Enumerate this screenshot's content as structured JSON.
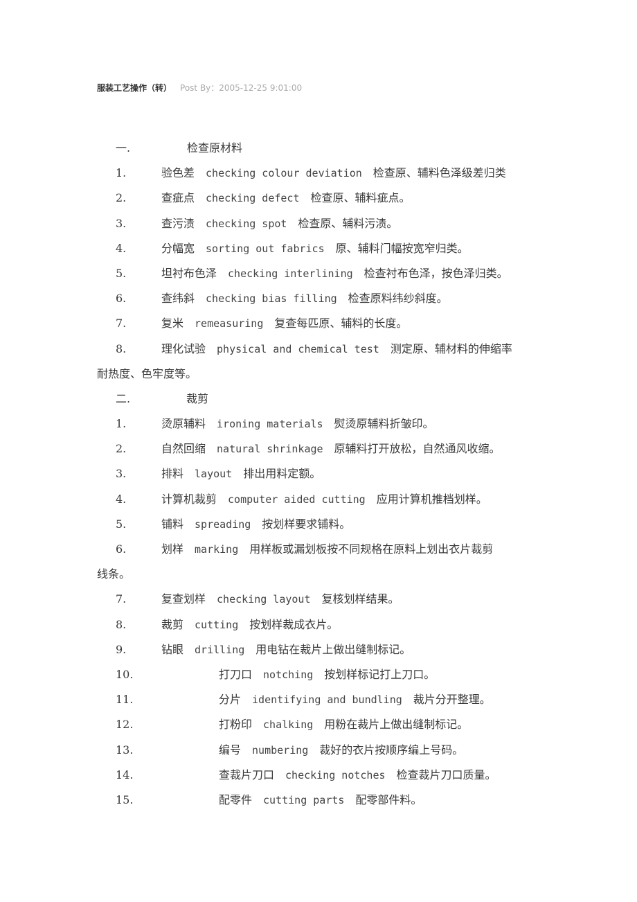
{
  "header": {
    "title": "服装工艺操作（转）",
    "meta": "Post By：2005-12-25 9:01:00"
  },
  "sections": [
    {
      "number": "一.",
      "title": "检查原材料",
      "items": [
        {
          "num": "1.",
          "zh": "验色差",
          "en": "checking colour deviation",
          "desc": "检查原、辅料色泽级差归类",
          "cont": ""
        },
        {
          "num": "2.",
          "zh": "查疵点",
          "en": "checking defect",
          "desc": "检查原、辅料疵点。",
          "cont": ""
        },
        {
          "num": "3.",
          "zh": "查污渍",
          "en": "checking spot",
          "desc": "检查原、辅料污渍。",
          "cont": ""
        },
        {
          "num": "4.",
          "zh": "分幅宽",
          "en": "sorting out fabrics",
          "desc": "原、辅料门幅按宽窄归类。",
          "cont": ""
        },
        {
          "num": "5.",
          "zh": "坦衬布色泽",
          "en": "checking interlining",
          "desc": "检查衬布色泽，按色泽归类。",
          "cont": ""
        },
        {
          "num": "6.",
          "zh": "查纬斜",
          "en": "checking bias filling",
          "desc": "检查原料纬纱斜度。",
          "cont": ""
        },
        {
          "num": "7.",
          "zh": "复米",
          "en": "remeasuring",
          "desc": "复查每匹原、辅料的长度。",
          "cont": ""
        },
        {
          "num": "8.",
          "zh": "理化试验",
          "en": "physical and chemical test",
          "desc": "测定原、辅材料的伸缩率",
          "cont": "耐热度、色牢度等。"
        }
      ]
    },
    {
      "number": "二.",
      "title": "裁剪",
      "items": [
        {
          "num": "1.",
          "zh": "烫原辅料",
          "en": "ironing materials",
          "desc": "熨烫原辅料折皱印。",
          "cont": ""
        },
        {
          "num": "2.",
          "zh": "自然回缩",
          "en": "natural shrinkage",
          "desc": "原辅料打开放松，自然通风收缩。",
          "cont": ""
        },
        {
          "num": "3.",
          "zh": "排料",
          "en": "layout",
          "desc": "排出用料定额。",
          "cont": ""
        },
        {
          "num": "4.",
          "zh": "计算机裁剪",
          "en": "computer aided cutting",
          "desc": "应用计算机推档划样。",
          "cont": ""
        },
        {
          "num": "5.",
          "zh": "铺料",
          "en": "spreading",
          "desc": "按划样要求铺料。",
          "cont": ""
        },
        {
          "num": "6.",
          "zh": "划样",
          "en": "marking",
          "desc": "用样板或漏划板按不同规格在原料上划出衣片裁剪",
          "cont": "线条。"
        },
        {
          "num": "7.",
          "zh": "复查划样",
          "en": "checking layout",
          "desc": "复核划样结果。",
          "cont": ""
        },
        {
          "num": "8.",
          "zh": "裁剪",
          "en": "cutting",
          "desc": "按划样裁成衣片。",
          "cont": ""
        },
        {
          "num": "9.",
          "zh": "钻眼",
          "en": "drilling",
          "desc": "用电钻在裁片上做出缝制标记。",
          "cont": ""
        },
        {
          "num": "10.",
          "zh": "打刀口",
          "en": "notching",
          "desc": "按划样标记打上刀口。",
          "cont": ""
        },
        {
          "num": "11.",
          "zh": "分片",
          "en": "identifying and bundling",
          "desc": "裁片分开整理。",
          "cont": ""
        },
        {
          "num": "12.",
          "zh": "打粉印",
          "en": "chalking",
          "desc": "用粉在裁片上做出缝制标记。",
          "cont": ""
        },
        {
          "num": "13.",
          "zh": "编号",
          "en": "numbering",
          "desc": "裁好的衣片按顺序编上号码。",
          "cont": ""
        },
        {
          "num": "14.",
          "zh": "查裁片刀口",
          "en": "checking notches",
          "desc": "检查裁片刀口质量。",
          "cont": ""
        },
        {
          "num": "15.",
          "zh": "配零件",
          "en": "cutting parts",
          "desc": "配零部件料。",
          "cont": ""
        }
      ]
    }
  ]
}
